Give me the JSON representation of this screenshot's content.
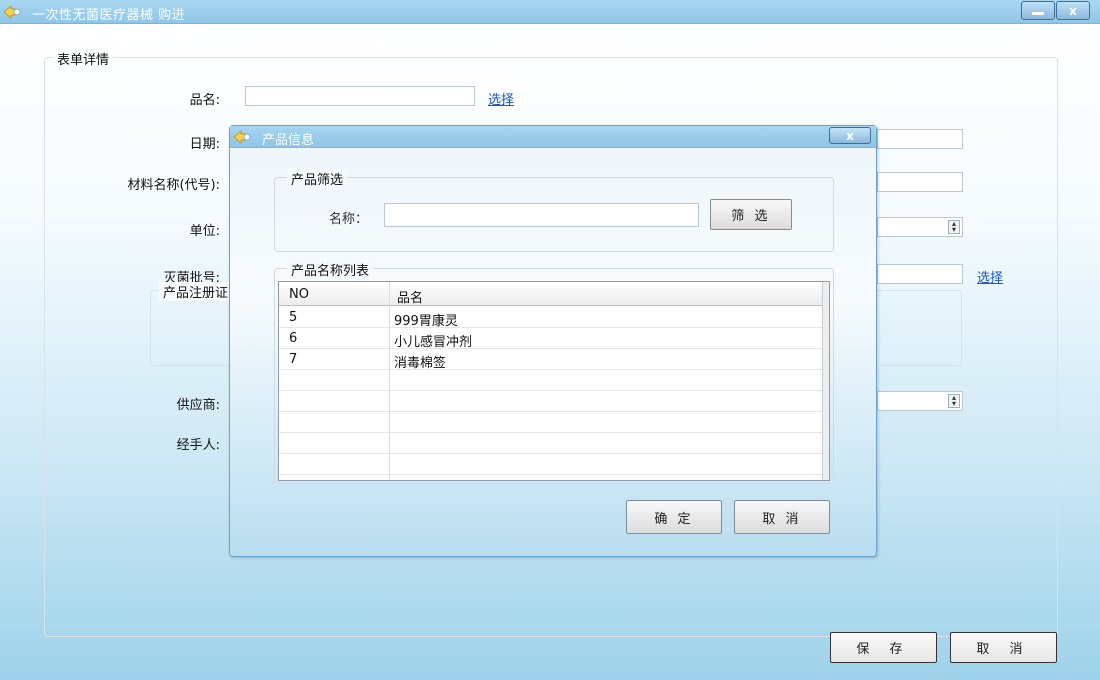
{
  "window": {
    "title": "一次性无菌医疗器械 购进",
    "minimize_label": "—",
    "close_label": "x"
  },
  "form": {
    "group_title": "表单详情",
    "labels": {
      "name": "品名:",
      "date": "日期:",
      "material": "材料名称(代号):",
      "unit": "单位:",
      "batch": "灭菌批号:",
      "supplier": "供应商:",
      "handler": "经手人:"
    },
    "registration_group_title": "产品注册证",
    "name_value": "",
    "select_link": "选择",
    "batch_select_link": "选择"
  },
  "footer": {
    "save_label": "保 存",
    "cancel_label": "取 消"
  },
  "dialog": {
    "title": "产品信息",
    "close_label": "x",
    "filter_group_title": "产品筛选",
    "filter_name_label": "名称：",
    "filter_value": "",
    "filter_button": "筛 选",
    "list_group_title": "产品名称列表",
    "columns": [
      "NO",
      "品名"
    ],
    "rows": [
      {
        "no": "5",
        "name": "999胃康灵"
      },
      {
        "no": "6",
        "name": "小儿感冒冲剂"
      },
      {
        "no": "7",
        "name": "消毒棉签"
      }
    ],
    "ok_button": "确 定",
    "cancel_button": "取 消"
  },
  "colors": {
    "titlebar": "#8fc6e8",
    "link": "#1a55c9",
    "background_gradient_end": "#9ed2ea"
  }
}
